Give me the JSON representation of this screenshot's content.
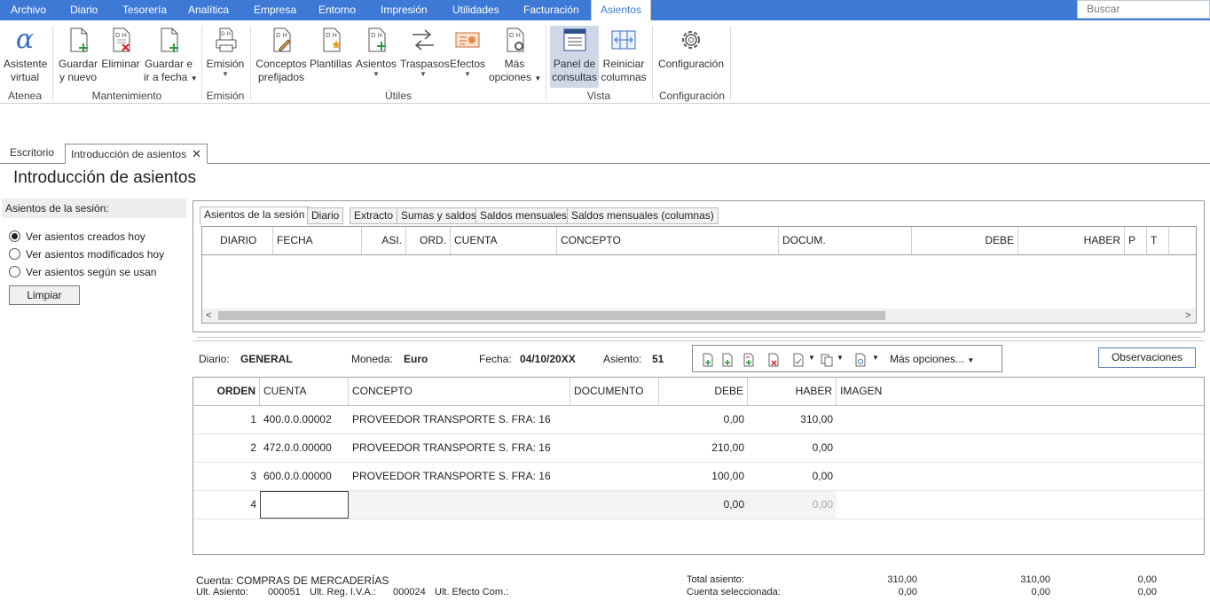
{
  "menu": {
    "items": [
      "Archivo",
      "Diario",
      "Tesorería",
      "Analítica",
      "Empresa",
      "Entorno",
      "Impresión",
      "Utilidades",
      "Facturación",
      "Asientos"
    ],
    "active": "Asientos",
    "search_placeholder": "Buscar"
  },
  "ribbon": {
    "atenea": {
      "label": "Atenea",
      "btn1": "Asistente",
      "btn2": "virtual"
    },
    "mantenimiento": {
      "label": "Mantenimiento",
      "guardar1": "Guardar",
      "guardar2": "y nuevo",
      "eliminar": "Eliminar",
      "guardarfecha1": "Guardar e",
      "guardarfecha2": "ir a fecha"
    },
    "emision": {
      "label": "Emisión",
      "btn": "Emisión"
    },
    "utiles": {
      "label": "Útiles",
      "conceptos1": "Conceptos",
      "conceptos2": "prefijados",
      "plantillas": "Plantillas",
      "asientos": "Asientos",
      "traspasos": "Traspasos",
      "efectos": "Efectos",
      "mas1": "Más",
      "mas2": "opciones"
    },
    "vista": {
      "label": "Vista",
      "panel1": "Panel de",
      "panel2": "consultas",
      "reiniciar1": "Reiniciar",
      "reiniciar2": "columnas"
    },
    "configuracion": {
      "label": "Configuración",
      "btn": "Configuración"
    }
  },
  "tabs": {
    "escritorio": "Escritorio",
    "intro": "Introducción de asientos",
    "close": "✕"
  },
  "page_title": "Introducción de asientos",
  "session": {
    "header": "Asientos de la sesión:",
    "opt1": "Ver asientos creados hoy",
    "opt2": "Ver asientos modificados hoy",
    "opt3": "Ver asientos según se usan",
    "clear": "Limpiar"
  },
  "session_tabs": [
    "Asientos de la sesión",
    "Diario",
    "Extracto",
    "Sumas y saldos",
    "Saldos mensuales",
    "Saldos mensuales (columnas)"
  ],
  "session_columns": [
    "DIARIO",
    "FECHA",
    "ASI.",
    "ORD.",
    "CUENTA",
    "CONCEPTO",
    "DOCUM.",
    "DEBE",
    "HABER",
    "P",
    "T"
  ],
  "info": {
    "diario_label": "Diario:",
    "diario": "GENERAL",
    "moneda_label": "Moneda:",
    "moneda": "Euro",
    "fecha_label": "Fecha:",
    "fecha": "04/10/20XX",
    "asiento_label": "Asiento:",
    "asiento": "51",
    "mas_opciones": "Más opciones...",
    "observaciones": "Observaciones"
  },
  "entry_columns": [
    "ORDEN",
    "CUENTA",
    "CONCEPTO",
    "DOCUMENTO",
    "DEBE",
    "HABER",
    "IMAGEN"
  ],
  "entries": [
    {
      "orden": "1",
      "cuenta": "400.0.0.00002",
      "concepto": "PROVEEDOR TRANSPORTE S. FRA:  16",
      "debe": "0,00",
      "haber": "310,00"
    },
    {
      "orden": "2",
      "cuenta": "472.0.0.00000",
      "concepto": "PROVEEDOR TRANSPORTE S. FRA:  16",
      "debe": "210,00",
      "haber": "0,00"
    },
    {
      "orden": "3",
      "cuenta": "600.0.0.00000",
      "concepto": "PROVEEDOR TRANSPORTE S. FRA:  16",
      "debe": "100,00",
      "haber": "0,00"
    }
  ],
  "new_entry": {
    "orden": "4",
    "debe": "0,00",
    "haber": "0,00"
  },
  "footer": {
    "cuenta": "Cuenta: COMPRAS DE MERCADERÍAS",
    "ult_asiento_label": "Ult. Asiento:",
    "ult_asiento": "000051",
    "ult_iva_label": "Ult. Reg. I.V.A.:",
    "ult_iva": "000024",
    "ult_efecto_label": "Ult. Efecto Com.:",
    "total_label": "Total asiento:",
    "total_debe": "310,00",
    "total_haber": "310,00",
    "total_saldo": "0,00",
    "sel_label": "Cuenta seleccionada:",
    "sel_debe": "0,00",
    "sel_haber": "0,00",
    "sel_saldo": "0,00"
  }
}
